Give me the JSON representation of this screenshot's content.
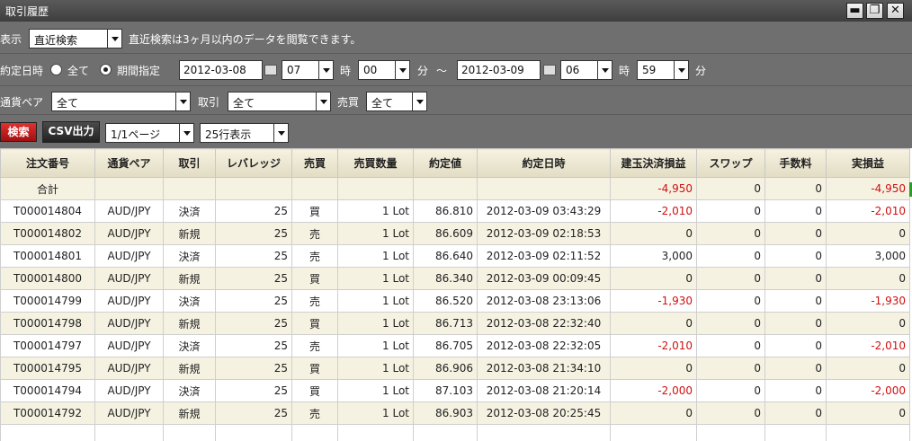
{
  "window": {
    "title": "取引履歴"
  },
  "filters": {
    "display_label": "表示",
    "display_value": "直近検索",
    "display_note": "直近検索は3ヶ月以内のデータを閲覧できます。",
    "exec_date_label": "約定日時",
    "all_label": "全て",
    "period_label": "期間指定",
    "from_date": "2012-03-08",
    "from_hour": "07",
    "hour_unit": "時",
    "from_min": "00",
    "min_unit": "分",
    "tilde": "～",
    "to_date": "2012-03-09",
    "to_hour": "06",
    "to_min": "59",
    "pair_label": "通貨ペア",
    "pair_value": "全て",
    "trade_label": "取引",
    "trade_value": "全て",
    "side_label": "売買",
    "side_value": "全て",
    "search_button": "検索",
    "csv_button": "CSV出力",
    "page_value": "1/1ページ",
    "rows_value": "25行表示"
  },
  "table": {
    "headers": [
      "注文番号",
      "通貨ペア",
      "取引",
      "レバレッジ",
      "売買",
      "売買数量",
      "約定値",
      "約定日時",
      "建玉決済損益",
      "スワップ",
      "手数料",
      "実損益"
    ],
    "total": [
      "合計",
      "",
      "",
      "",
      "",
      "",
      "",
      "",
      "-4,950",
      "0",
      "0",
      "-4,950"
    ],
    "rows": [
      [
        "T000014804",
        "AUD/JPY",
        "決済",
        "25",
        "買",
        "1 Lot",
        "86.810",
        "2012-03-09 03:43:29",
        "-2,010",
        "0",
        "0",
        "-2,010"
      ],
      [
        "T000014802",
        "AUD/JPY",
        "新規",
        "25",
        "売",
        "1 Lot",
        "86.609",
        "2012-03-09 02:18:53",
        "0",
        "0",
        "0",
        "0"
      ],
      [
        "T000014801",
        "AUD/JPY",
        "決済",
        "25",
        "売",
        "1 Lot",
        "86.640",
        "2012-03-09 02:11:52",
        "3,000",
        "0",
        "0",
        "3,000"
      ],
      [
        "T000014800",
        "AUD/JPY",
        "新規",
        "25",
        "買",
        "1 Lot",
        "86.340",
        "2012-03-09 00:09:45",
        "0",
        "0",
        "0",
        "0"
      ],
      [
        "T000014799",
        "AUD/JPY",
        "決済",
        "25",
        "売",
        "1 Lot",
        "86.520",
        "2012-03-08 23:13:06",
        "-1,930",
        "0",
        "0",
        "-1,930"
      ],
      [
        "T000014798",
        "AUD/JPY",
        "新規",
        "25",
        "買",
        "1 Lot",
        "86.713",
        "2012-03-08 22:32:40",
        "0",
        "0",
        "0",
        "0"
      ],
      [
        "T000014797",
        "AUD/JPY",
        "決済",
        "25",
        "売",
        "1 Lot",
        "86.705",
        "2012-03-08 22:32:05",
        "-2,010",
        "0",
        "0",
        "-2,010"
      ],
      [
        "T000014795",
        "AUD/JPY",
        "新規",
        "25",
        "買",
        "1 Lot",
        "86.906",
        "2012-03-08 21:34:10",
        "0",
        "0",
        "0",
        "0"
      ],
      [
        "T000014794",
        "AUD/JPY",
        "決済",
        "25",
        "買",
        "1 Lot",
        "87.103",
        "2012-03-08 21:20:14",
        "-2,000",
        "0",
        "0",
        "-2,000"
      ],
      [
        "T000014792",
        "AUD/JPY",
        "新規",
        "25",
        "売",
        "1 Lot",
        "86.903",
        "2012-03-08 20:25:45",
        "0",
        "0",
        "0",
        "0"
      ]
    ]
  },
  "colors": {
    "negative": "#d01010",
    "accent_red": "#c01818"
  }
}
